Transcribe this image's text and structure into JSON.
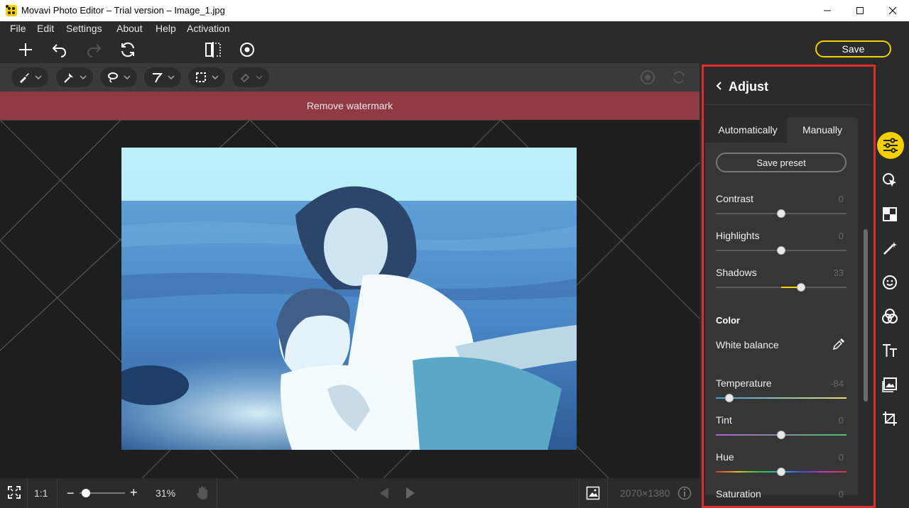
{
  "window": {
    "title": "Movavi Photo Editor – Trial version – Image_1.jpg"
  },
  "menu": [
    "File",
    "Edit",
    "Settings",
    "About",
    "Help",
    "Activation"
  ],
  "toolbar": {
    "save_label": "Save"
  },
  "banner": {
    "text": "Remove watermark"
  },
  "status": {
    "one_to_one": "1:1",
    "zoom": "31%",
    "dimensions": "2070×1380",
    "zoom_slider_percent": 31
  },
  "panel": {
    "title": "Adjust",
    "tabs": [
      "Automatically",
      "Manually"
    ],
    "active_tab": "Manually",
    "save_preset": "Save preset",
    "sliders": [
      {
        "label": "Contrast",
        "value": "0"
      },
      {
        "label": "Highlights",
        "value": "0"
      },
      {
        "label": "Shadows",
        "value": "33"
      }
    ],
    "color_section": "Color",
    "white_balance": "White balance",
    "color_sliders": [
      {
        "label": "Temperature",
        "value": "-84"
      },
      {
        "label": "Tint",
        "value": "0"
      },
      {
        "label": "Hue",
        "value": "0"
      },
      {
        "label": "Saturation",
        "value": "0"
      }
    ]
  },
  "colors": {
    "accent": "#f5d000",
    "banner": "#8f3a44",
    "highlight_border": "#e32b2b"
  },
  "rail_icons": [
    "adjust-icon",
    "object-select-icon",
    "background-icon",
    "magic-wand-icon",
    "face-icon",
    "filters-icon",
    "text-icon",
    "insert-image-icon",
    "crop-icon"
  ]
}
